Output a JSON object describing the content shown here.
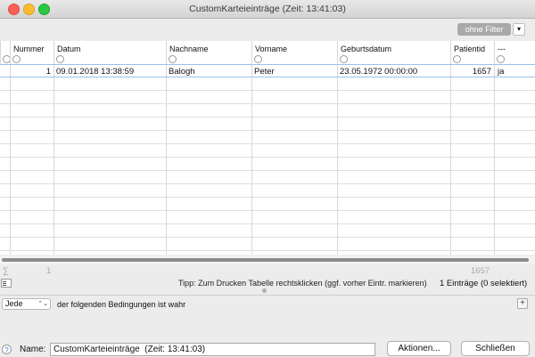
{
  "window": {
    "title": "CustomKarteieinträge  (Zeit: 13:41:03)"
  },
  "toolbar": {
    "filter_label": "ohne Filter",
    "filter_menu_glyph": "▾"
  },
  "table": {
    "columns": [
      "Nummer",
      "Datum",
      "Nachname",
      "Vorname",
      "Geburtsdatum",
      "Patientid",
      "---"
    ],
    "rows": [
      {
        "nummer": "1",
        "datum": "09.01.2018 13:38:59",
        "nachname": "Balogh",
        "vorname": "Peter",
        "geburtsdatum": "23.05.1972 00:00:00",
        "patientid": "1657",
        "flag": "ja"
      }
    ],
    "sum_symbol": "∑",
    "sum_nummer": "1",
    "sum_patientid": "1657"
  },
  "status": {
    "tip": "Tipp: Zum Drucken Tabelle rechtsklicken (ggf. vorher Eintr. markieren)",
    "count": "1 Einträge (0 selektiert)"
  },
  "conditions": {
    "mode_value": "Jede",
    "mode_arrow": "⌃⌄",
    "suffix": "der folgenden Bedingungen ist wahr",
    "add_glyph": "+"
  },
  "footer": {
    "help_glyph": "?",
    "name_label": "Name:",
    "name_value": "CustomKarteieinträge  (Zeit: 13:41:03)",
    "actions_label": "Aktionen...",
    "close_label": "Schließen"
  }
}
